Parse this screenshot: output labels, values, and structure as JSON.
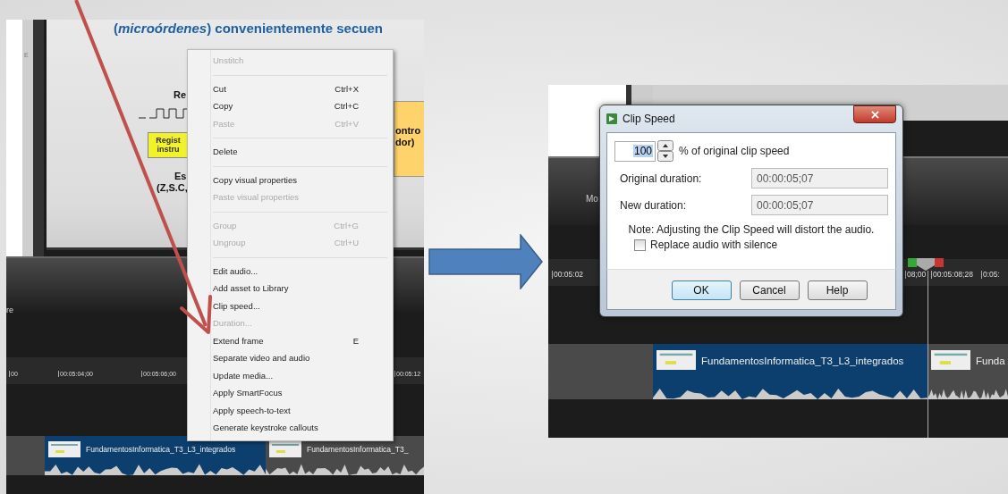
{
  "left_screenshot": {
    "slide_preview": {
      "heading": "(*microórdenes*) convenientemente secuen",
      "fragments": [
        {
          "kind": "plain",
          "text": "Re"
        },
        {
          "kind": "yellow_box",
          "text": "Regist instru"
        },
        {
          "kind": "plain",
          "text": "Es"
        },
        {
          "kind": "plain",
          "text": "(Z,S.C,"
        },
        {
          "kind": "orange_box",
          "text": "ontro dor)"
        }
      ],
      "side_mark": "E"
    },
    "toolbar_label": "re",
    "ruler": [
      "00",
      "00:05:04;00",
      "00:05:06;00",
      "00:05:12"
    ],
    "clips": [
      {
        "name": "FundamentosInformatica_T3_L3_integrados",
        "selected": true
      },
      {
        "name": "FundamentosInformatica_T3_",
        "selected": false
      }
    ],
    "context_menu": {
      "items": [
        {
          "kind": "item",
          "label": "Unstitch",
          "disabled": true
        },
        {
          "kind": "separator"
        },
        {
          "kind": "item",
          "label": "Cut",
          "shortcut": "Ctrl+X",
          "disabled": false
        },
        {
          "kind": "item",
          "label": "Copy",
          "shortcut": "Ctrl+C",
          "disabled": false
        },
        {
          "kind": "item",
          "label": "Paste",
          "shortcut": "Ctrl+V",
          "disabled": true
        },
        {
          "kind": "separator"
        },
        {
          "kind": "item",
          "label": "Delete",
          "disabled": false
        },
        {
          "kind": "separator"
        },
        {
          "kind": "item",
          "label": "Copy visual properties",
          "disabled": false
        },
        {
          "kind": "item",
          "label": "Paste visual properties",
          "disabled": true
        },
        {
          "kind": "separator"
        },
        {
          "kind": "item",
          "label": "Group",
          "shortcut": "Ctrl+G",
          "disabled": true
        },
        {
          "kind": "item",
          "label": "Ungroup",
          "shortcut": "Ctrl+U",
          "disabled": true
        },
        {
          "kind": "separator"
        },
        {
          "kind": "item",
          "label": "Edit audio...",
          "disabled": false
        },
        {
          "kind": "item",
          "label": "Add asset to Library",
          "disabled": false
        },
        {
          "kind": "item",
          "label": "Clip speed...",
          "disabled": false
        },
        {
          "kind": "item",
          "label": "Duration...",
          "disabled": true
        },
        {
          "kind": "item",
          "label": "Extend frame",
          "shortcut": "E",
          "disabled": false
        },
        {
          "kind": "item",
          "label": "Separate video and audio",
          "disabled": false
        },
        {
          "kind": "item",
          "label": "Update media...",
          "disabled": false
        },
        {
          "kind": "item",
          "label": "Apply SmartFocus",
          "disabled": false
        },
        {
          "kind": "item",
          "label": "Apply speech-to-text",
          "disabled": false
        },
        {
          "kind": "item",
          "label": "Generate keystroke callouts",
          "disabled": false
        }
      ]
    }
  },
  "right_screenshot": {
    "toolbar_label": "Mo",
    "ruler": [
      "00:05:02",
      "08;00",
      "00:05:08;28",
      "0:05:"
    ],
    "clips": [
      {
        "name": "FundamentosInformatica_T3_L3_integrados",
        "selected": true
      },
      {
        "name": "Funda",
        "selected": false
      }
    ],
    "dialog": {
      "title": "Clip Speed",
      "speed": {
        "value": "100",
        "selected": true
      },
      "speed_label": "% of original clip speed",
      "fields": [
        {
          "label": "Original duration:",
          "value": "00:00:05;07"
        },
        {
          "label": "New duration:",
          "value": "00:00:05;07"
        }
      ],
      "note": "Note: Adjusting the Clip Speed will distort the audio.",
      "checkbox": {
        "label": "Replace audio with silence",
        "checked": false
      },
      "buttons": [
        {
          "label": "OK",
          "default": true
        },
        {
          "label": "Cancel",
          "default": false
        },
        {
          "label": "Help",
          "default": false
        }
      ]
    }
  }
}
